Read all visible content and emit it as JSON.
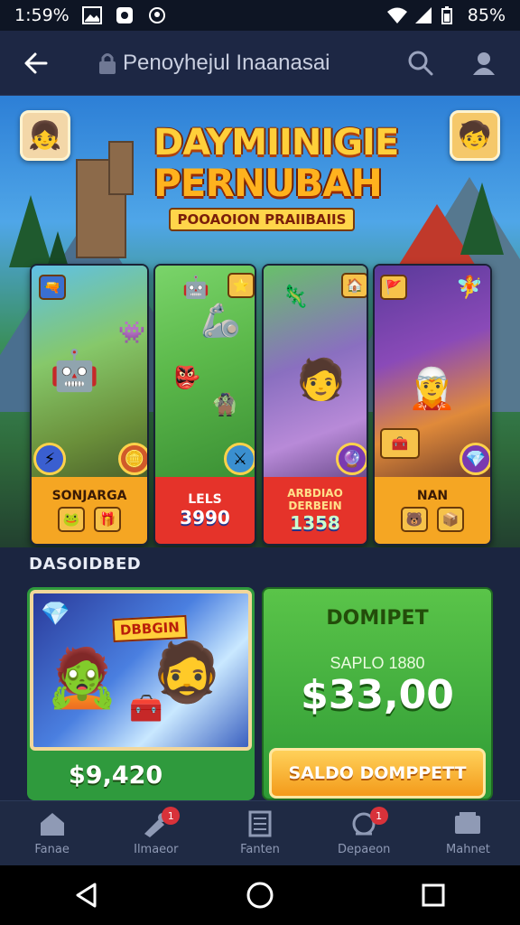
{
  "status_bar": {
    "time": "1:59%",
    "battery": "85%"
  },
  "app_bar": {
    "title": "Penoyhejul Inaanasai"
  },
  "hero": {
    "logo_line1": "DAYMIINIGIE",
    "logo_line2": "PERNUBAH",
    "logo_tagline": "POOAOION PRAIIBAIIS"
  },
  "game_cards": [
    {
      "label": "SONJARGA",
      "value": "",
      "accent": "#f5a623"
    },
    {
      "label": "LELS",
      "value": "3990",
      "accent": "#e5332a"
    },
    {
      "label": "ARBDIAO DERBEIN",
      "value": "1358",
      "accent": "#e5332a"
    },
    {
      "label": "NAN",
      "value": "",
      "accent": "#f5a623"
    }
  ],
  "section": {
    "title": "DASOIDBED"
  },
  "promo": {
    "banner": "DBBGIN",
    "price": "$9,420"
  },
  "wallet": {
    "title": "DOMIPET",
    "subtitle": "SAPLO 1880",
    "amount": "$33,00",
    "button": "SALDO DOMPPETT"
  },
  "bottom_nav": [
    {
      "label": "Fanae",
      "icon": "home-icon"
    },
    {
      "label": "Ilmaeor",
      "icon": "gift-icon",
      "badge": "1"
    },
    {
      "label": "Fanten",
      "icon": "list-icon"
    },
    {
      "label": "Depaeon",
      "icon": "deposit-icon",
      "badge": "1"
    },
    {
      "label": "Mahnet",
      "icon": "wallet-icon"
    }
  ],
  "colors": {
    "app_bar": "#1d2744",
    "accent_orange": "#f5a623",
    "accent_green": "#2e9a35",
    "nav_bg": "#1f2a44"
  }
}
